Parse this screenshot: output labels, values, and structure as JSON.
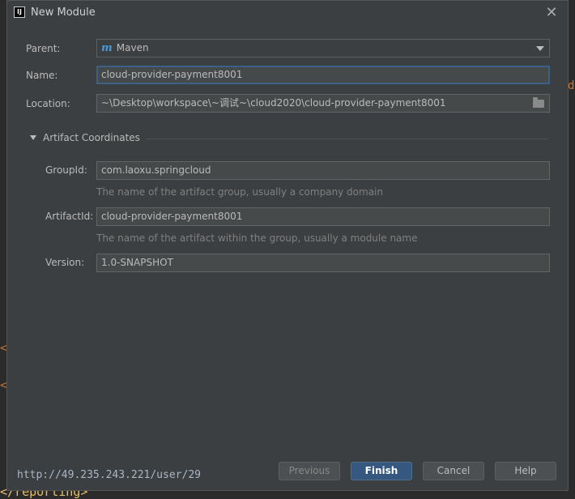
{
  "window": {
    "title": "New Module",
    "app_icon": "intellij-icon",
    "close_icon": "close-icon",
    "close_glyph": "✕"
  },
  "form": {
    "parent": {
      "label": "Parent:",
      "value": "Maven",
      "icon": "maven-icon",
      "icon_glyph": "m"
    },
    "name": {
      "label": "Name:",
      "value": "cloud-provider-payment8001"
    },
    "location": {
      "label": "Location:",
      "value": "~\\Desktop\\workspace\\~调试~\\cloud2020\\cloud-provider-payment8001",
      "icon": "folder-icon"
    }
  },
  "artifact": {
    "section_title": "Artifact Coordinates",
    "group_id": {
      "label": "GroupId:",
      "value": "com.laoxu.springcloud",
      "hint": "The name of the artifact group, usually a company domain"
    },
    "artifact_id": {
      "label": "ArtifactId:",
      "value": "cloud-provider-payment8001",
      "hint": "The name of the artifact within the group, usually a module name"
    },
    "version": {
      "label": "Version:",
      "value": "1.0-SNAPSHOT"
    }
  },
  "footer": {
    "url_text": "http://49.235.243.221/user/29",
    "buttons": {
      "previous": "Previous",
      "finish": "Finish",
      "cancel": "Cancel",
      "help": "Help"
    }
  },
  "background": {
    "edge_chars": [
      "d",
      "<",
      "<"
    ],
    "bottom_code": "</reporting>"
  },
  "colors": {
    "dialog_bg": "#3c3f41",
    "field_bg": "#45494a",
    "primary_button": "#365880",
    "focus_border": "#3d6185",
    "hint_text": "#808080"
  }
}
